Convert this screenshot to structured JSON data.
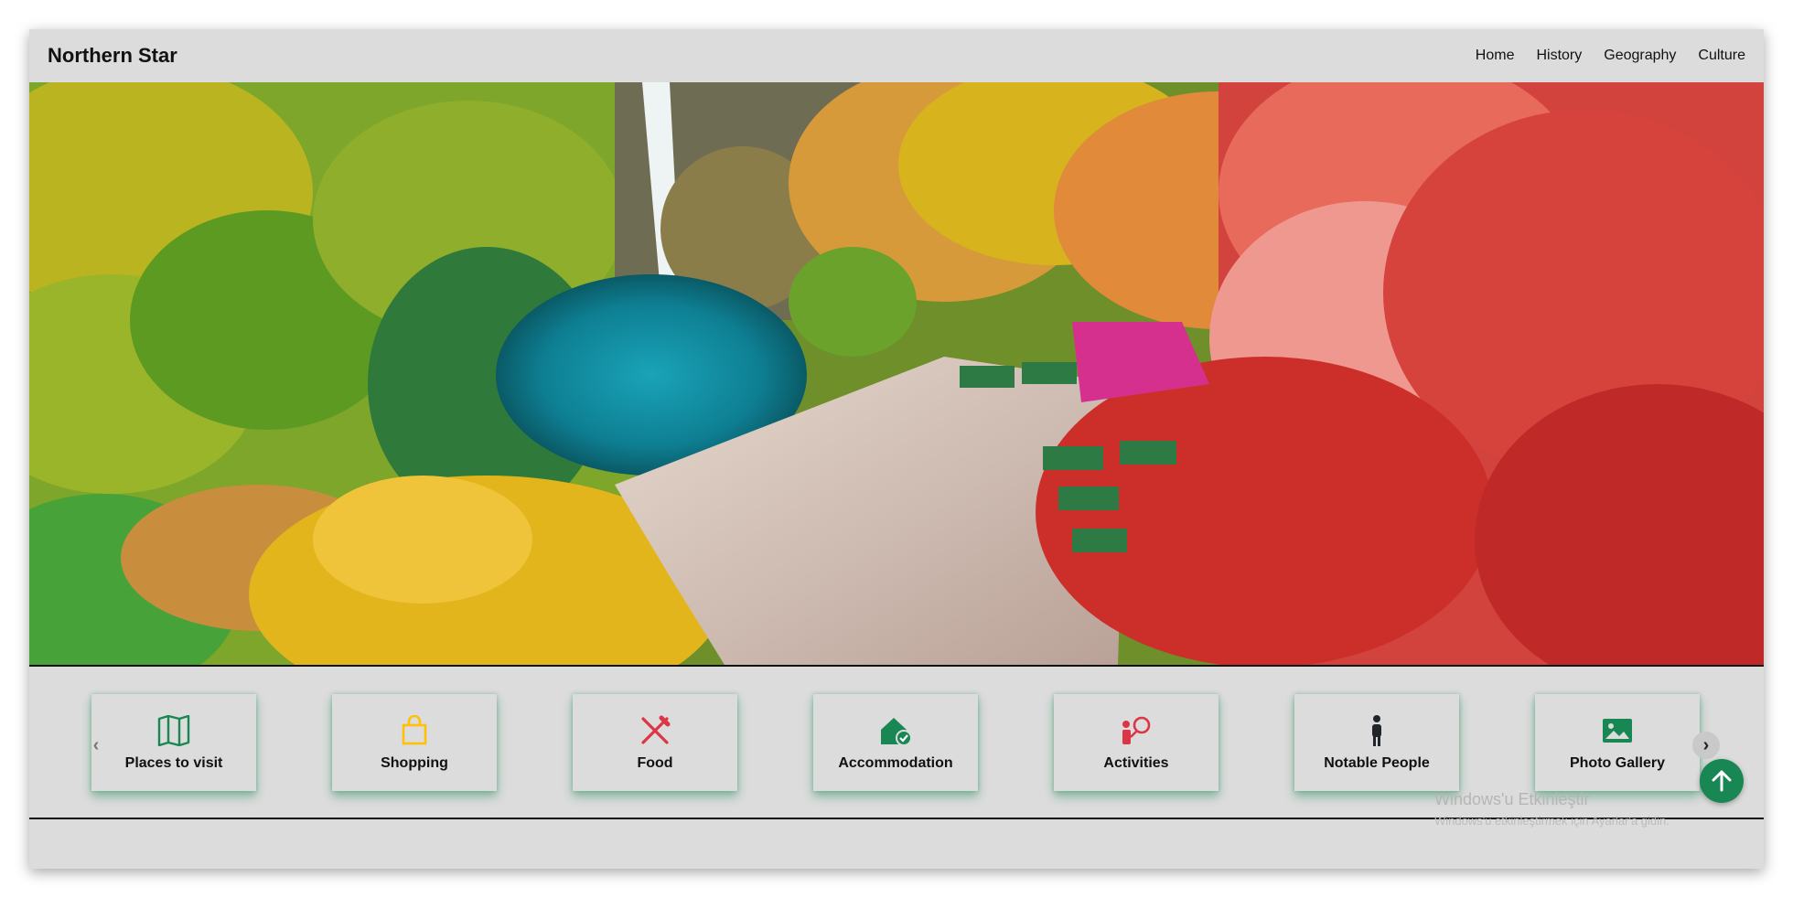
{
  "navbar": {
    "brand": "Northern Star",
    "links": [
      "Home",
      "History",
      "Geography",
      "Culture"
    ]
  },
  "hero": {
    "icon": "waterfall-forest-photo"
  },
  "cards": [
    {
      "label": "Places to visit",
      "icon": "map-icon",
      "color": "#198754"
    },
    {
      "label": "Shopping",
      "icon": "shopping-bag-icon",
      "color": "#ffc107"
    },
    {
      "label": "Food",
      "icon": "utensils-icon",
      "color": "#dc3545"
    },
    {
      "label": "Accommodation",
      "icon": "house-check-icon",
      "color": "#198754"
    },
    {
      "label": "Activities",
      "icon": "person-activity-icon",
      "color": "#dc3545"
    },
    {
      "label": "Notable People",
      "icon": "person-standing-icon",
      "color": "#212529"
    },
    {
      "label": "Photo Gallery",
      "icon": "image-icon",
      "color": "#198754"
    }
  ],
  "carousel": {
    "prev_icon": "chevron-left-icon",
    "next_icon": "chevron-right-icon"
  },
  "watermark": {
    "title": "Windows'u Etkinleştir",
    "subtitle": "Windows'u etkinleştirmek için Ayarlar'a gidin."
  },
  "scroll_top": {
    "icon": "arrow-up-icon",
    "color": "#198754"
  }
}
